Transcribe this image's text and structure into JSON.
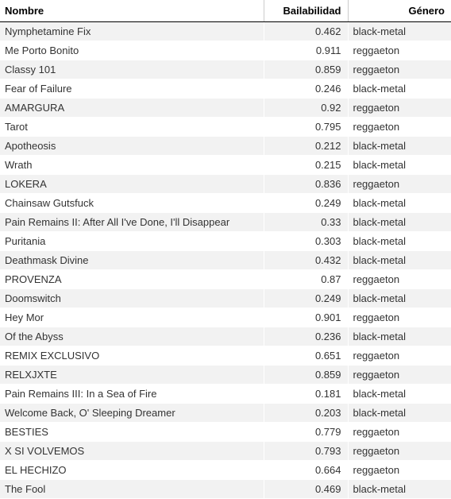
{
  "columns": {
    "name": "Nombre",
    "bail": "Bailabilidad",
    "genre": "Género"
  },
  "rows": [
    {
      "name": "Nymphetamine Fix",
      "bail": "0.462",
      "genre": "black-metal"
    },
    {
      "name": "Me Porto Bonito",
      "bail": "0.911",
      "genre": "reggaeton"
    },
    {
      "name": "Classy 101",
      "bail": "0.859",
      "genre": "reggaeton"
    },
    {
      "name": "Fear of Failure",
      "bail": "0.246",
      "genre": "black-metal"
    },
    {
      "name": "AMARGURA",
      "bail": "0.92",
      "genre": "reggaeton"
    },
    {
      "name": "Tarot",
      "bail": "0.795",
      "genre": "reggaeton"
    },
    {
      "name": "Apotheosis",
      "bail": "0.212",
      "genre": "black-metal"
    },
    {
      "name": "Wrath",
      "bail": "0.215",
      "genre": "black-metal"
    },
    {
      "name": "LOKERA",
      "bail": "0.836",
      "genre": "reggaeton"
    },
    {
      "name": "Chainsaw Gutsfuck",
      "bail": "0.249",
      "genre": "black-metal"
    },
    {
      "name": "Pain Remains II: After All I've Done, I'll Disappear",
      "bail": "0.33",
      "genre": "black-metal"
    },
    {
      "name": "Puritania",
      "bail": "0.303",
      "genre": "black-metal"
    },
    {
      "name": "Deathmask Divine",
      "bail": "0.432",
      "genre": "black-metal"
    },
    {
      "name": "PROVENZA",
      "bail": "0.87",
      "genre": "reggaeton"
    },
    {
      "name": "Doomswitch",
      "bail": "0.249",
      "genre": "black-metal"
    },
    {
      "name": "Hey Mor",
      "bail": "0.901",
      "genre": "reggaeton"
    },
    {
      "name": "Of the Abyss",
      "bail": "0.236",
      "genre": "black-metal"
    },
    {
      "name": "REMIX EXCLUSIVO",
      "bail": "0.651",
      "genre": "reggaeton"
    },
    {
      "name": "RELXJXTE",
      "bail": "0.859",
      "genre": "reggaeton"
    },
    {
      "name": "Pain Remains III: In a Sea of Fire",
      "bail": "0.181",
      "genre": "black-metal"
    },
    {
      "name": "Welcome Back, O' Sleeping Dreamer",
      "bail": "0.203",
      "genre": "black-metal"
    },
    {
      "name": "BESTIES",
      "bail": "0.779",
      "genre": "reggaeton"
    },
    {
      "name": "X SI VOLVEMOS",
      "bail": "0.793",
      "genre": "reggaeton"
    },
    {
      "name": "EL HECHIZO",
      "bail": "0.664",
      "genre": "reggaeton"
    },
    {
      "name": "The Fool",
      "bail": "0.469",
      "genre": "black-metal"
    }
  ]
}
